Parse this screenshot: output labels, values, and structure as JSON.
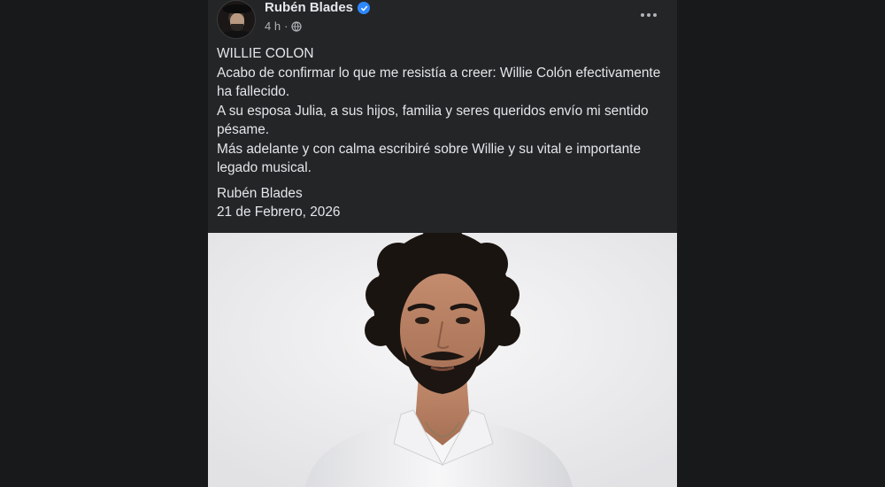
{
  "post": {
    "author": "Rubén Blades",
    "verified_icon": "verified-badge-icon",
    "time": "4 h",
    "separator": "·",
    "audience_icon": "globe-icon",
    "more_icon": "more-horizontal-icon",
    "text_lines": [
      "WILLIE COLON",
      "Acabo de confirmar lo que me resistía a creer: Willie Colón efectivamente ha fallecido.",
      "A su esposa Julia, a sus hijos, familia y seres queridos envío mi sentido pésame.",
      "Más adelante y con calma escribiré sobre Willie y su vital e importante legado musical."
    ],
    "signature_name": "Rubén Blades",
    "signature_date": "21 de Febrero, 2026"
  },
  "colors": {
    "background": "#18191a",
    "card": "#242526",
    "primary_text": "#e4e6eb",
    "secondary_text": "#b0b3b8",
    "verified": "#2d88ff"
  }
}
